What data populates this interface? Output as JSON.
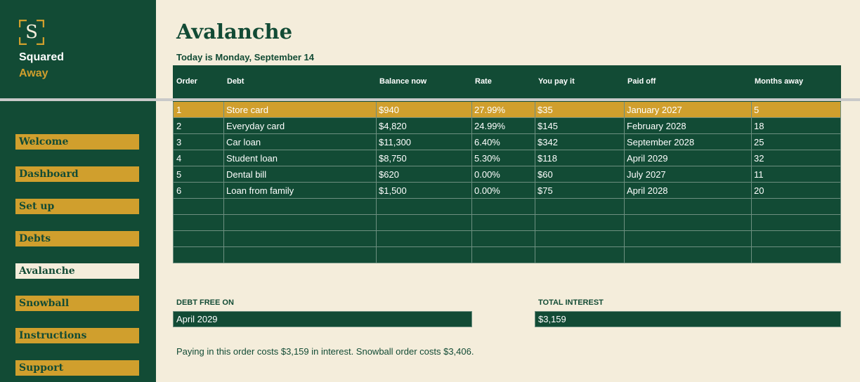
{
  "brand": {
    "logo_letter": "S",
    "line1": "Squared",
    "line2": "Away"
  },
  "nav": [
    {
      "label": "Welcome"
    },
    {
      "label": "Dashboard"
    },
    {
      "label": "Set up"
    },
    {
      "label": "Debts"
    },
    {
      "label": "Avalanche"
    },
    {
      "label": "Snowball"
    },
    {
      "label": "Instructions"
    },
    {
      "label": "Support"
    }
  ],
  "nav_active": "Avalanche",
  "page": {
    "title": "Avalanche",
    "today": "Today is Monday, September 14"
  },
  "table": {
    "headers": [
      "Order",
      "Debt",
      "Balance now",
      "Rate",
      "You pay it",
      "Paid off",
      "Months away"
    ],
    "rows": [
      [
        "1",
        "Store card",
        "$940",
        "27.99%",
        "$35",
        "January 2027",
        "5"
      ],
      [
        "2",
        "Everyday card",
        "$4,820",
        "24.99%",
        "$145",
        "February 2028",
        "18"
      ],
      [
        "3",
        "Car loan",
        "$11,300",
        "6.40%",
        "$342",
        "September 2028",
        "25"
      ],
      [
        "4",
        "Student loan",
        "$8,750",
        "5.30%",
        "$118",
        "April 2029",
        "32"
      ],
      [
        "5",
        "Dental bill",
        "$620",
        "0.00%",
        "$60",
        "July 2027",
        "11"
      ],
      [
        "6",
        "Loan from family",
        "$1,500",
        "0.00%",
        "$75",
        "April 2028",
        "20"
      ]
    ],
    "selected_row": 0
  },
  "summary": {
    "debt_free_label": "DEBT FREE ON",
    "debt_free_value": "April 2029",
    "total_interest_label": "TOTAL INTEREST",
    "total_interest_value": "$3,159",
    "note": "Paying in this order costs $3,159 in interest. Snowball order costs $3,406."
  },
  "colors": {
    "green": "#124b35",
    "gold": "#d09f2d",
    "cream": "#f4eddb"
  }
}
